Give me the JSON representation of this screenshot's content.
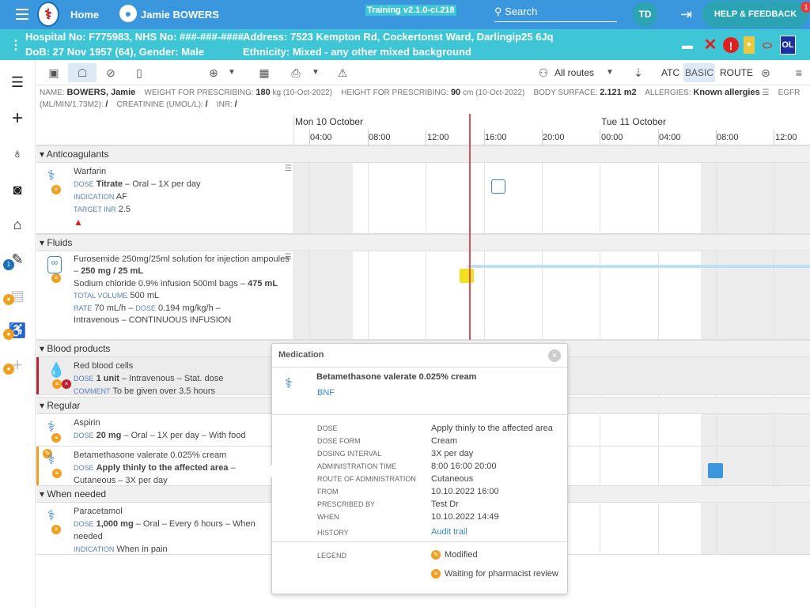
{
  "topbar": {
    "home": "Home",
    "patient": "Jamie BOWERS",
    "training": "Training v2.1.0-ci.218",
    "search": "Search",
    "avatar": "TD",
    "help": "HELP & FEEDBACK",
    "help_badge": "1"
  },
  "patient_bar": {
    "line1_left": "Hospital No: F775983, NHS No: ###-###-####",
    "line1_right": "Address: 7523 Kempton Rd, Cockertonst Ward, Darlingip25 6Jq",
    "line2_left": "DoB: 27 Nov 1957 (64), Gender: Male",
    "line2_right": "Ethnicity: Mixed - any other mixed background",
    "ol": "OL"
  },
  "sidebar": {
    "badge": "1"
  },
  "toolbar": {
    "routes": "All routes",
    "atc": "ATC",
    "basic": "BASIC",
    "route": "ROUTE"
  },
  "infobar": {
    "name_lbl": "NAME:",
    "name": "BOWERS, Jamie",
    "weight_lbl": "WEIGHT FOR PRESCRIBING:",
    "weight": "180",
    "weight_unit": "kg (10-Oct-2022)",
    "height_lbl": "HEIGHT FOR PRESCRIBING:",
    "height": "90",
    "height_unit": "cm (10-Oct-2022)",
    "bsa_lbl": "BODY SURFACE:",
    "bsa": "2.121 m2",
    "allergy_lbl": "ALLERGIES:",
    "allergy": "Known allergies",
    "egfr_lbl": "EGFR",
    "egfr_unit": "(ML/MIN/1.73M2):",
    "egfr": "/",
    "creat_lbl": "CREATININE (UMOL/L):",
    "creat": "/",
    "inr_lbl": "INR:",
    "inr": "/"
  },
  "timeline": {
    "day1": "Mon 10 October",
    "day2": "Tue 11 October",
    "hours": [
      "04:00",
      "08:00",
      "12:00",
      "16:00",
      "20:00",
      "00:00",
      "04:00",
      "08:00",
      "12:00"
    ]
  },
  "sections": {
    "anticoag": "Anticoagulants",
    "fluids": "Fluids",
    "blood": "Blood products",
    "regular": "Regular",
    "when_needed": "When needed"
  },
  "meds": {
    "warfarin": {
      "name": "Warfarin",
      "dose_lbl": "DOSE",
      "dose_b": "Titrate",
      "dose": "– Oral – 1X per day",
      "ind_lbl": "INDICATION",
      "ind": "AF",
      "inr_lbl": "TARGET INR",
      "inr": "2.5"
    },
    "fluid": {
      "l1": "Furosemide 250mg/25ml solution for injection ampoules –",
      "l1b": "250 mg / 25 mL",
      "l2": "Sodium chloride 0.9% infusion 500ml bags –",
      "l2b": "475 mL",
      "vol_lbl": "TOTAL VOLUME",
      "vol": "500 mL",
      "rate_lbl": "RATE",
      "rate": "70 mL/h –",
      "dose_lbl": "DOSE",
      "dose": "0.194 mg/kg/h –",
      "route": "Intravenous – CONTINUOUS INFUSION"
    },
    "blood": {
      "name": "Red blood cells",
      "dose_lbl": "DOSE",
      "dose_b": "1 unit",
      "dose": "– Intravenous – Stat. dose",
      "com_lbl": "COMMENT",
      "com": "To be given over 3.5 hours"
    },
    "aspirin": {
      "name": "Aspirin",
      "dose_lbl": "DOSE",
      "dose_b": "20 mg",
      "dose": "– Oral – 1X per day – With food"
    },
    "beta": {
      "name": "Betamethasone valerate 0.025% cream",
      "dose_lbl": "DOSE",
      "dose_b": "Apply thinly to the affected area",
      "dose": "–",
      "route": "Cutaneous – 3X per day"
    },
    "para": {
      "name": "Paracetamol",
      "dose_lbl": "DOSE",
      "dose_b": "1,000 mg",
      "dose": "– Oral – Every 6 hours – When",
      "dose2": "needed",
      "ind_lbl": "INDICATION",
      "ind": "When in pain"
    }
  },
  "popup": {
    "title": "Medication",
    "med": "Betamethasone valerate 0.025% cream",
    "bnf": "BNF",
    "fields": [
      {
        "label": "DOSE",
        "value": "Apply thinly to the affected area"
      },
      {
        "label": "DOSE FORM",
        "value": "Cream"
      },
      {
        "label": "DOSING INTERVAL",
        "value": "3X per day"
      },
      {
        "label": "ADMINISTRATION TIME",
        "value": "8:00 16:00 20:00"
      },
      {
        "label": "ROUTE OF ADMINISTRATION",
        "value": "Cutaneous"
      },
      {
        "label": "FROM",
        "value": "10.10.2022 16:00"
      },
      {
        "label": "PRESCRIBED BY",
        "value": "Test Dr"
      },
      {
        "label": "WHEN",
        "value": "10.10.2022 14:49"
      }
    ],
    "history_lbl": "HISTORY",
    "history": "Audit trail",
    "legend_lbl": "LEGEND",
    "legend1": "Modified",
    "legend2": "Waiting for pharmacist review"
  },
  "colors": {
    "topbar": "#3a96dd",
    "patientbar": "#3ec6d6",
    "accent": "#3a86cc",
    "warning": "#f0a020",
    "now_line": "#e05050"
  }
}
